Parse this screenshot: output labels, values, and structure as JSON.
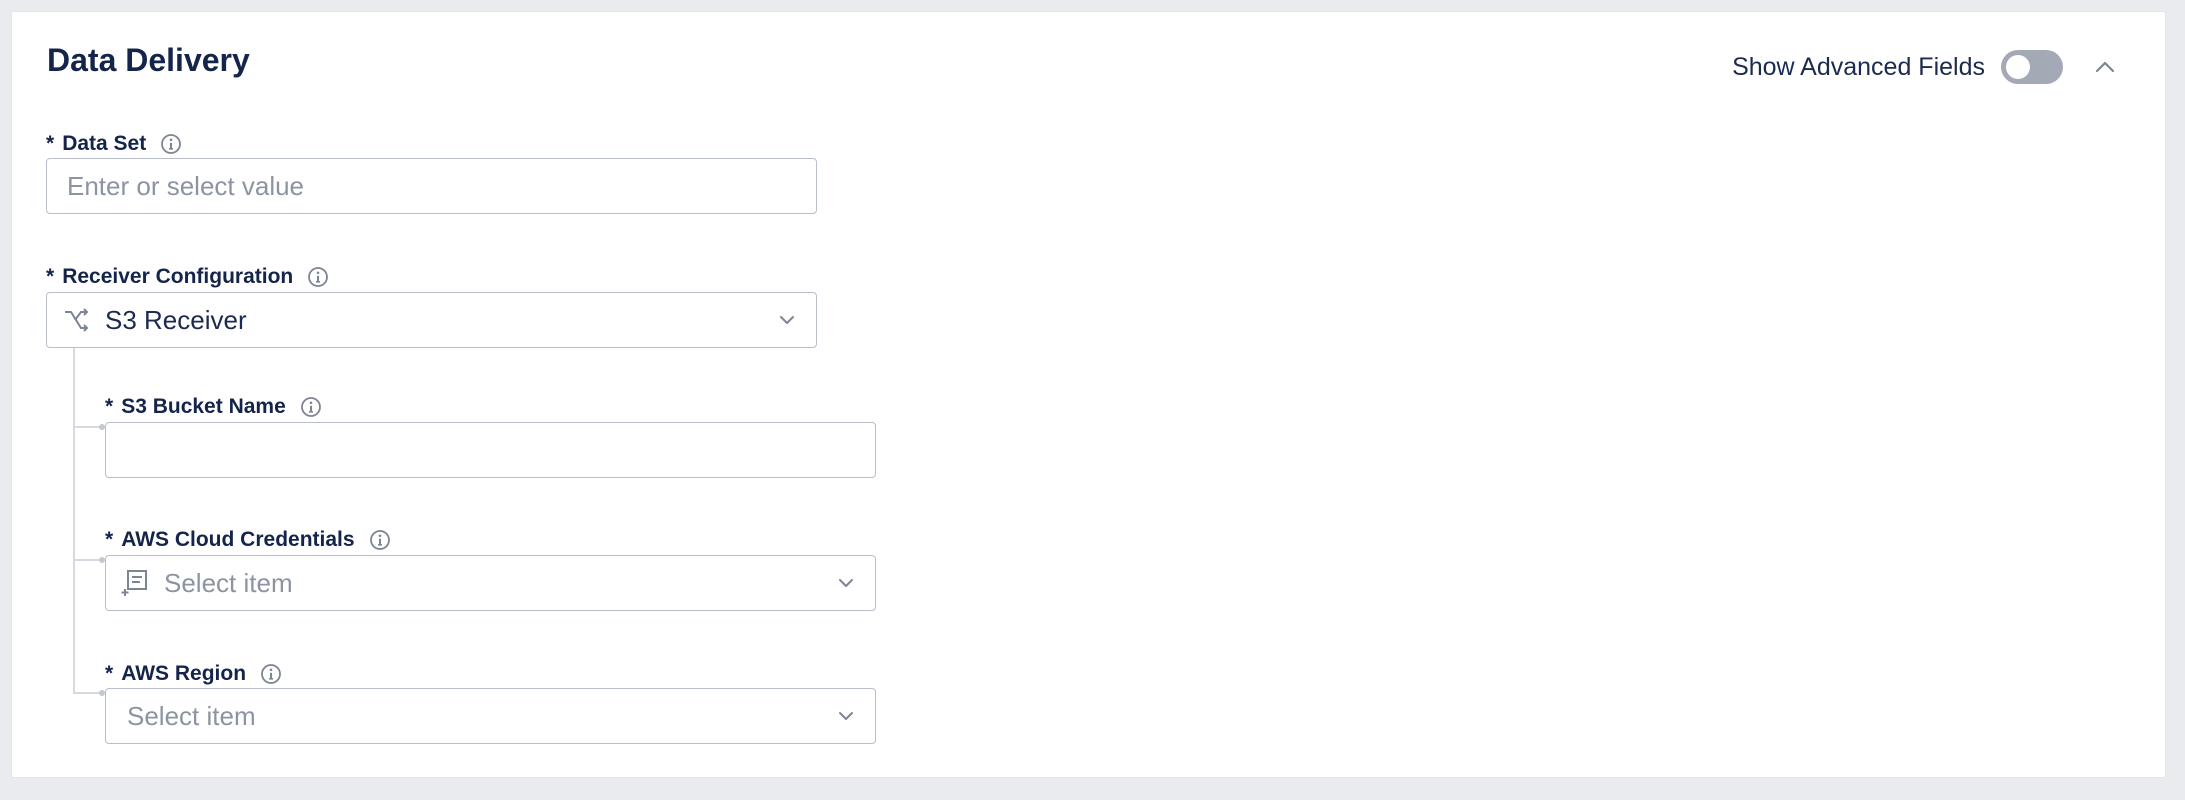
{
  "panel": {
    "title": "Data Delivery",
    "advanced_toggle_label": "Show Advanced Fields",
    "advanced_toggle_on": false
  },
  "fields": {
    "data_set": {
      "required_mark": "*",
      "label": "Data Set",
      "placeholder": "Enter or select value"
    },
    "receiver_configuration": {
      "required_mark": "*",
      "label": "Receiver Configuration",
      "value": "S3 Receiver"
    },
    "s3_bucket_name": {
      "required_mark": "*",
      "label": "S3 Bucket Name",
      "value": ""
    },
    "aws_cloud_credentials": {
      "required_mark": "*",
      "label": "AWS Cloud Credentials",
      "placeholder": "Select item"
    },
    "aws_region": {
      "required_mark": "*",
      "label": "AWS Region",
      "placeholder": "Select item"
    }
  },
  "icons": {
    "info": "info-icon",
    "chevron_down": "chevron-down-icon",
    "chevron_up": "chevron-up-icon",
    "receiver": "route-split-icon",
    "credentials": "credentials-icon"
  },
  "colors": {
    "title": "#15244a",
    "toggle_off": "#a3a9b5",
    "border": "#b9bfc8",
    "placeholder": "#8c94a3",
    "background": "#e9ebee"
  }
}
